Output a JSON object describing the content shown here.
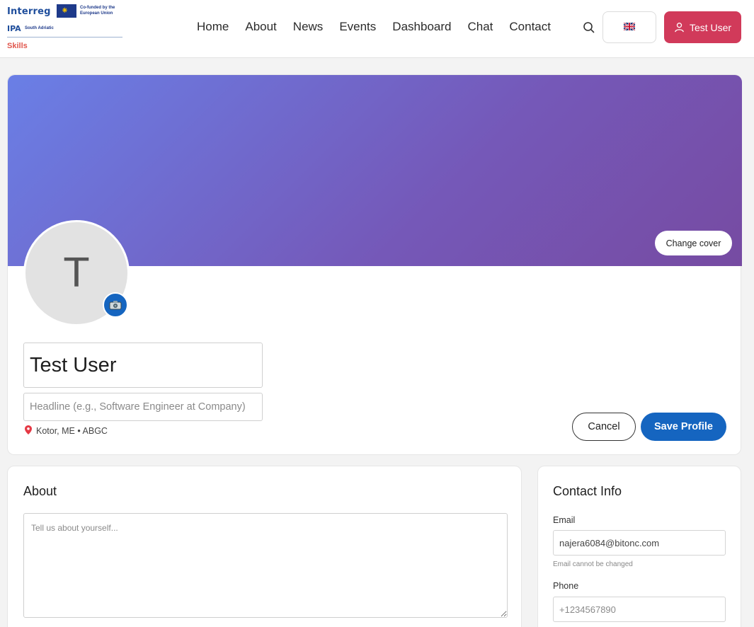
{
  "logo": {
    "interreg": "Interreg",
    "cofunded": "Co-funded by the European Union",
    "ipa": "IPA",
    "region": "South Adriatic",
    "skills": "Skills"
  },
  "nav": {
    "items": [
      "Home",
      "About",
      "News",
      "Events",
      "Dashboard",
      "Chat",
      "Contact"
    ]
  },
  "header": {
    "language_flag": "🇬🇧",
    "user_label": "Test User"
  },
  "profile": {
    "change_cover_label": "Change cover",
    "avatar_initial": "T",
    "camera_icon": "📷",
    "name_value": "Test User",
    "headline_placeholder": "Headline (e.g., Software Engineer at Company)",
    "location_icon": "📍",
    "location_text": "Kotor, ME • ABGC",
    "cancel_label": "Cancel",
    "save_label": "Save Profile"
  },
  "about": {
    "title": "About",
    "placeholder": "Tell us about yourself..."
  },
  "contact": {
    "title": "Contact Info",
    "email_label": "Email",
    "email_value": "najera6084@bitonc.com",
    "email_note": "Email cannot be changed",
    "phone_label": "Phone",
    "phone_placeholder": "+1234567890"
  },
  "colors": {
    "primary": "#1565c0",
    "user_button": "#d13a5a",
    "cover_start": "#6a7fe6",
    "cover_end": "#764ba2"
  }
}
